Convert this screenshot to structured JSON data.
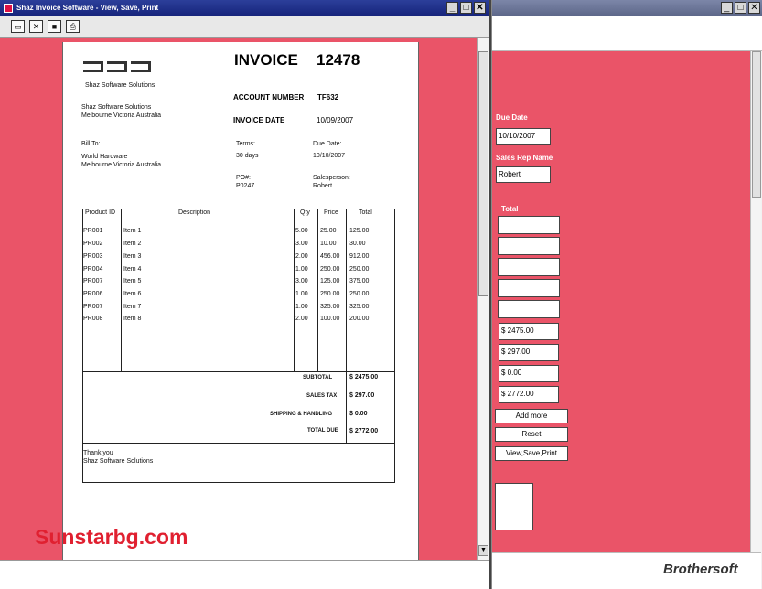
{
  "window": {
    "title": "Shaz Invoice Software - View, Save, Print"
  },
  "colors": {
    "canvas": "#ea5468",
    "titlebar": "#15237a",
    "watermark": "#e02030"
  },
  "toolbar": {
    "icons": [
      "open-icon",
      "close-icon",
      "save-icon",
      "print-icon"
    ]
  },
  "invoice": {
    "title_label": "INVOICE",
    "number": "12478",
    "company_tagline": "Shaz Software Solutions",
    "from_name": "Shaz Software Solutions",
    "from_address": "Melbourne Victoria Australia",
    "account_number_label": "ACCOUNT NUMBER",
    "account_number": "TF632",
    "invoice_date_label": "INVOICE DATE",
    "invoice_date": "10/09/2007",
    "bill_to_label": "Bill To:",
    "bill_to_name": "World Hardware",
    "bill_to_address": "Melbourne Victoria Australia",
    "terms_label": "Terms:",
    "terms_value": "30 days",
    "due_date_label": "Due Date:",
    "due_date_value": "10/10/2007",
    "po_label": "PO#:",
    "po_value": "P0247",
    "salesperson_label": "Salesperson:",
    "salesperson_value": "Robert",
    "columns": [
      "Product ID",
      "Description",
      "Qty",
      "Price",
      "Total"
    ],
    "rows": [
      [
        "PR001",
        "Item 1",
        "5.00",
        "25.00",
        "125.00"
      ],
      [
        "PR002",
        "Item 2",
        "3.00",
        "10.00",
        "30.00"
      ],
      [
        "PR003",
        "Item 3",
        "2.00",
        "456.00",
        "912.00"
      ],
      [
        "PR004",
        "Item 4",
        "1.00",
        "250.00",
        "250.00"
      ],
      [
        "PR007",
        "Item 5",
        "3.00",
        "125.00",
        "375.00"
      ],
      [
        "PR006",
        "Item 6",
        "1.00",
        "250.00",
        "250.00"
      ],
      [
        "PR007",
        "Item 7",
        "1.00",
        "325.00",
        "325.00"
      ],
      [
        "PR008",
        "Item 8",
        "2.00",
        "100.00",
        "200.00"
      ]
    ],
    "subtotal_label": "SUBTOTAL",
    "subtotal_value": "$ 2475.00",
    "sales_tax_label": "SALES TAX",
    "sales_tax_value": "$ 297.00",
    "shipping_label": "SHIPPING & HANDLING",
    "shipping_value": "$ 0.00",
    "total_due_label": "TOTAL DUE",
    "total_due_value": "$ 2772.00",
    "thanks_line1": "Thank you",
    "thanks_line2": "Shaz Software Solutions"
  },
  "form": {
    "due_date_label": "Due Date",
    "due_date_value": "10/10/2007",
    "sales_rep_label": "Sales Rep Name",
    "sales_rep_value": "Robert",
    "total_label": "Total",
    "subtotal_value": "$ 2475.00",
    "tax_value": "$ 297.00",
    "shipping_value": "$ 0.00",
    "total_value": "$ 2772.00",
    "add_more_label": "Add more",
    "reset_label": "Reset",
    "view_save_print_label": "View,Save,Print"
  },
  "watermark": "Sunstarbg.com",
  "brand": "Brothersoft"
}
